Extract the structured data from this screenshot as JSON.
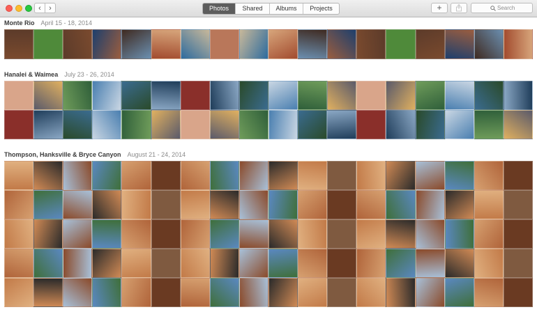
{
  "window": {
    "nav": {
      "back_glyph": "‹",
      "forward_glyph": "›"
    },
    "tabs": [
      {
        "label": "Photos",
        "active": true
      },
      {
        "label": "Shared",
        "active": false
      },
      {
        "label": "Albums",
        "active": false
      },
      {
        "label": "Projects",
        "active": false
      }
    ],
    "add_glyph": "+",
    "share_icon": "share-icon",
    "search": {
      "placeholder": "Search",
      "icon": "search-icon"
    }
  },
  "moments": [
    {
      "name": "Monte Rio",
      "dates": "April 15 - 18, 2014",
      "palette": [
        "#7a4a2e",
        "#b9775a",
        "#5c3b2a",
        "#d7a57b",
        "#3f2a20",
        "#9a5d3f",
        "#2d6b9e",
        "#4f8a3a",
        "#c8b89a",
        "#1d3f6d",
        "#6b8fb0",
        "#a24b2e"
      ]
    },
    {
      "name": "Hanalei & Waimea",
      "dates": "July 23 - 26, 2014",
      "palette": [
        "#4a7fb0",
        "#2f5f3a",
        "#8aa7c4",
        "#d9a58a",
        "#1f3d5a",
        "#6f9c5a",
        "#c9d6e3",
        "#3a6b8f",
        "#e0b060",
        "#8a2f2a",
        "#5a5a6a",
        "#2a4a2a"
      ]
    },
    {
      "name": "Thompson, Hanksville & Bryce Canyon",
      "dates": "August 21 - 24, 2014",
      "palette": [
        "#b0643a",
        "#d08a55",
        "#8a4a2a",
        "#5a88c0",
        "#e0b080",
        "#6a3a22",
        "#c27a48",
        "#3f6f3a",
        "#a8c0d8",
        "#2a2a2a",
        "#d6a070",
        "#7f5a40"
      ]
    }
  ]
}
